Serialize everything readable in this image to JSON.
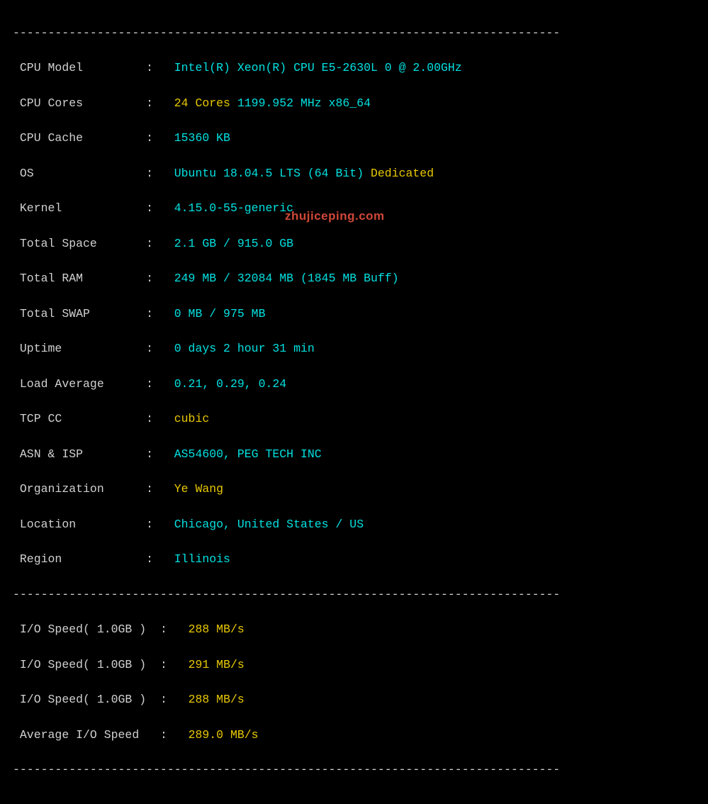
{
  "dash_line": "------------------------------------------------------------------------------",
  "rows": {
    "cpu_model": {
      "label": "CPU Model         ",
      "v1": "Intel(R) Xeon(R) CPU E5-2630L 0 @ 2.00GHz"
    },
    "cpu_cores": {
      "label": "CPU Cores         ",
      "v1": "24 Cores",
      "v2": " 1199.952 MHz x86_64"
    },
    "cpu_cache": {
      "label": "CPU Cache         ",
      "v1": "15360 KB"
    },
    "os": {
      "label": "OS                ",
      "v1": "Ubuntu 18.04.5 LTS (64 Bit)",
      "v2": " Dedicated"
    },
    "kernel": {
      "label": "Kernel            ",
      "v1": "4.15.0-55-generic"
    },
    "total_space": {
      "label": "Total Space       ",
      "v1": "2.1 GB / 915.0 GB"
    },
    "total_ram": {
      "label": "Total RAM         ",
      "v1": "249 MB / 32084 MB (1845 MB Buff)"
    },
    "total_swap": {
      "label": "Total SWAP        ",
      "v1": "0 MB / 975 MB"
    },
    "uptime": {
      "label": "Uptime            ",
      "v1": "0 days 2 hour 31 min"
    },
    "load_avg": {
      "label": "Load Average      ",
      "v1": "0.21, 0.29, 0.24"
    },
    "tcp_cc": {
      "label": "TCP CC            ",
      "v1": "cubic"
    },
    "asn_isp": {
      "label": "ASN & ISP         ",
      "v1": "AS54600, PEG TECH INC"
    },
    "org": {
      "label": "Organization      ",
      "v1": "Ye Wang"
    },
    "location": {
      "label": "Location          ",
      "v1": "Chicago, United States / US"
    },
    "region": {
      "label": "Region            ",
      "v1": "Illinois"
    }
  },
  "io": {
    "r1": {
      "label": "I/O Speed( 1.0GB )  ",
      "val": "288 MB/s"
    },
    "r2": {
      "label": "I/O Speed( 1.0GB )  ",
      "val": "291 MB/s"
    },
    "r3": {
      "label": "I/O Speed( 1.0GB )  ",
      "val": "288 MB/s"
    },
    "avg": {
      "label": "Average I/O Speed   ",
      "val": "289.0 MB/s"
    }
  },
  "watermark": "zhujiceping.com"
}
